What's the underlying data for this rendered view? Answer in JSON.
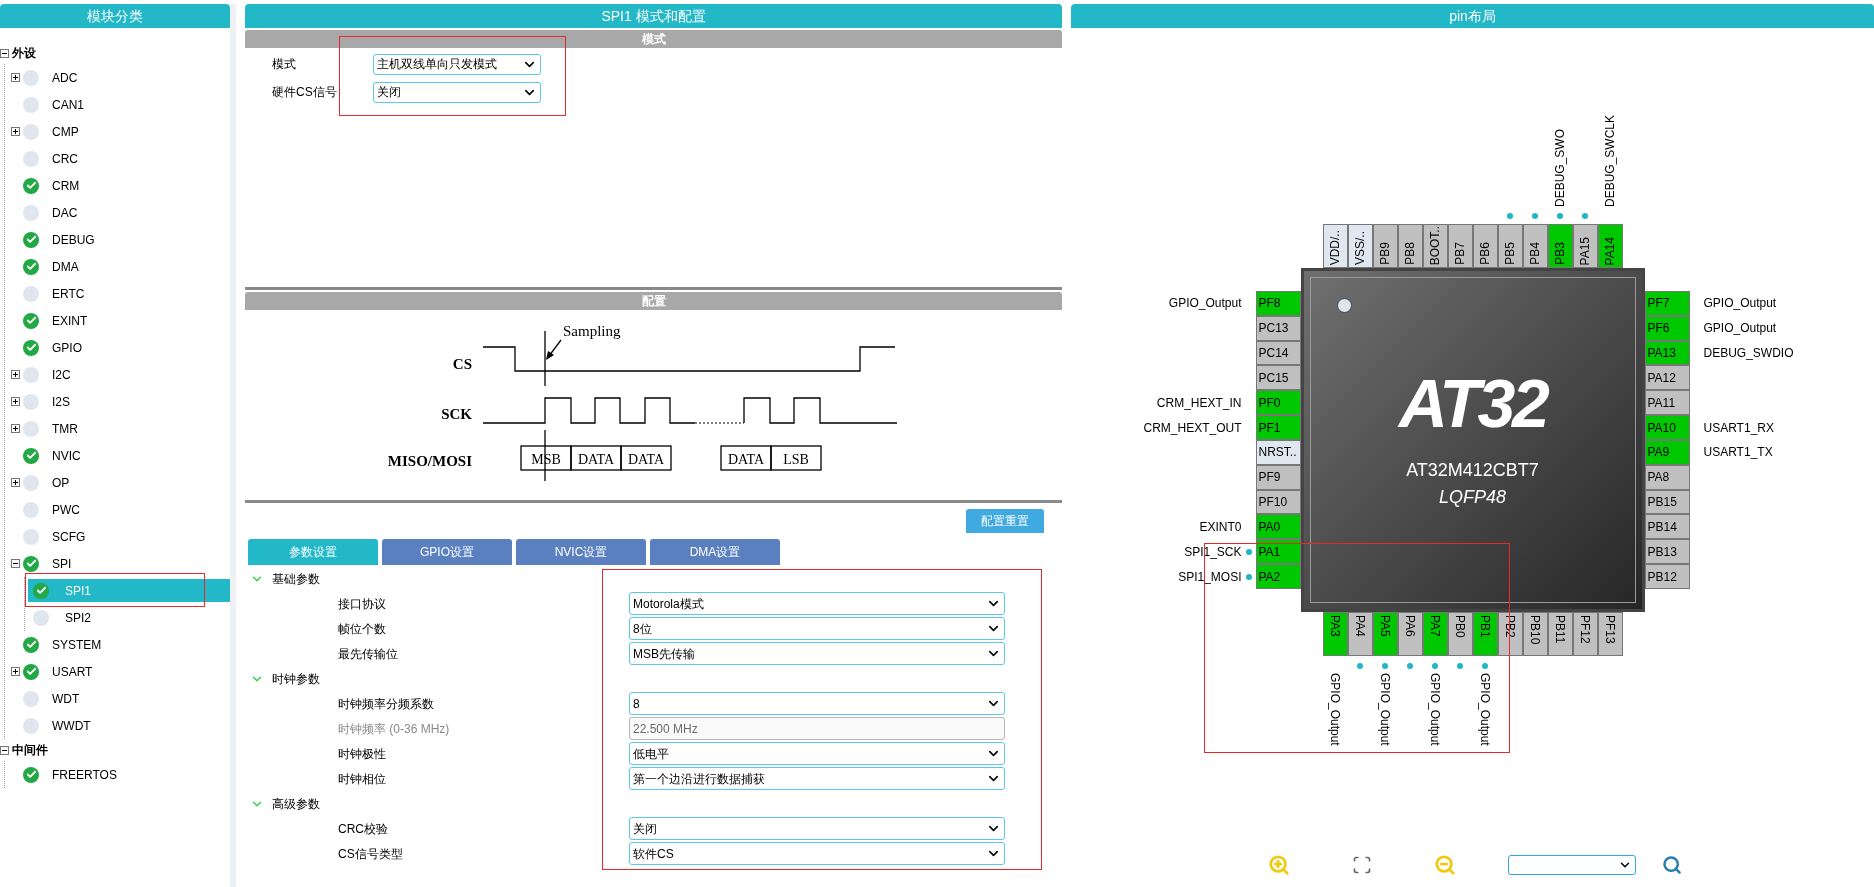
{
  "sidebar": {
    "title": "模块分类",
    "groups": [
      {
        "label": "外设",
        "expanded": true,
        "items": [
          {
            "label": "ADC",
            "enabled": false,
            "expanded": false,
            "selected": false
          },
          {
            "label": "CAN1",
            "enabled": false,
            "selected": false
          },
          {
            "label": "CMP",
            "enabled": false,
            "expanded": false,
            "selected": false
          },
          {
            "label": "CRC",
            "enabled": false,
            "selected": false
          },
          {
            "label": "CRM",
            "enabled": true,
            "selected": false
          },
          {
            "label": "DAC",
            "enabled": false,
            "selected": false
          },
          {
            "label": "DEBUG",
            "enabled": true,
            "selected": false
          },
          {
            "label": "DMA",
            "enabled": true,
            "selected": false
          },
          {
            "label": "ERTC",
            "enabled": false,
            "selected": false
          },
          {
            "label": "EXINT",
            "enabled": true,
            "selected": false
          },
          {
            "label": "GPIO",
            "enabled": true,
            "selected": false
          },
          {
            "label": "I2C",
            "enabled": false,
            "expanded": false,
            "selected": false
          },
          {
            "label": "I2S",
            "enabled": false,
            "expanded": false,
            "selected": false
          },
          {
            "label": "TMR",
            "enabled": false,
            "expanded": false,
            "selected": false
          },
          {
            "label": "NVIC",
            "enabled": true,
            "selected": false
          },
          {
            "label": "OP",
            "enabled": false,
            "expanded": false,
            "selected": false
          },
          {
            "label": "PWC",
            "enabled": false,
            "selected": false
          },
          {
            "label": "SCFG",
            "enabled": false,
            "selected": false
          },
          {
            "label": "SPI",
            "enabled": true,
            "expanded": true,
            "selected": false,
            "children": [
              {
                "label": "SPI1",
                "enabled": true,
                "selected": true,
                "highlighted": true
              },
              {
                "label": "SPI2",
                "enabled": false,
                "selected": false,
                "highlighted": false
              }
            ]
          },
          {
            "label": "SYSTEM",
            "enabled": true,
            "selected": false
          },
          {
            "label": "USART",
            "enabled": true,
            "expanded": false,
            "selected": false
          },
          {
            "label": "WDT",
            "enabled": false,
            "selected": false
          },
          {
            "label": "WWDT",
            "enabled": false,
            "selected": false
          }
        ]
      },
      {
        "label": "中间件",
        "expanded": true,
        "items": [
          {
            "label": "FREERTOS",
            "enabled": true,
            "selected": false
          }
        ]
      }
    ]
  },
  "main": {
    "title": "SPI1 模式和配置",
    "mode": {
      "title": "模式",
      "highlighted": true,
      "fields": [
        {
          "label": "模式",
          "value": "主机双线单向只发模式"
        },
        {
          "label": "硬件CS信号",
          "value": "关闭"
        }
      ]
    },
    "config": {
      "title": "配置",
      "timing_diagram": {
        "signals": [
          "CS",
          "SCK",
          "MISO/MOSI"
        ],
        "annotation": "Sampling",
        "frames": [
          "MSB",
          "DATA",
          "DATA",
          "DATA",
          "LSB"
        ]
      },
      "reset_button": "配置重置",
      "tabs": [
        {
          "label": "参数设置",
          "selected": true
        },
        {
          "label": "GPIO设置",
          "selected": false
        },
        {
          "label": "NVIC设置",
          "selected": false
        },
        {
          "label": "DMA设置",
          "selected": false
        }
      ],
      "highlighted": true,
      "groups": [
        {
          "title": "基础参数",
          "expanded": true,
          "params": [
            {
              "label": "接口协议",
              "value": "Motorola模式",
              "kind": "select"
            },
            {
              "label": "帧位个数",
              "value": "8位",
              "kind": "select"
            },
            {
              "label": "最先传输位",
              "value": "MSB先传输",
              "kind": "select"
            }
          ]
        },
        {
          "title": "时钟参数",
          "expanded": true,
          "params": [
            {
              "label": "时钟频率分频系数",
              "value": "8",
              "kind": "select"
            },
            {
              "label": "时钟频率 (0-36 MHz)",
              "value": "22.500 MHz",
              "kind": "readonly"
            },
            {
              "label": "时钟极性",
              "value": "低电平",
              "kind": "select"
            },
            {
              "label": "时钟相位",
              "value": "第一个边沿进行数据捕获",
              "kind": "select"
            }
          ]
        },
        {
          "title": "高级参数",
          "expanded": true,
          "params": [
            {
              "label": "CRC校验",
              "value": "关闭",
              "kind": "select"
            },
            {
              "label": "CS信号类型",
              "value": "软件CS",
              "kind": "select"
            }
          ]
        }
      ]
    }
  },
  "pinout": {
    "title": "pin布局",
    "highlighted": true,
    "chip": {
      "logo": "AT32",
      "part": "AT32M412CBT7",
      "package": "LQFP48"
    },
    "pins": {
      "top": [
        {
          "name": "VDD/..",
          "color": "#dfe8f1",
          "dot": false
        },
        {
          "name": "VSS/..",
          "color": "#dfe8f1",
          "dot": false
        },
        {
          "name": "PB9",
          "color": "#c0c0c0",
          "dot": false
        },
        {
          "name": "PB8",
          "color": "#c0c0c0",
          "dot": false
        },
        {
          "name": "BOOT..",
          "color": "#c0c0c0",
          "dot": false
        },
        {
          "name": "PB7",
          "color": "#c0c0c0",
          "dot": false
        },
        {
          "name": "PB6",
          "color": "#c0c0c0",
          "dot": false
        },
        {
          "name": "PB5",
          "color": "#c0c0c0",
          "dot": true
        },
        {
          "name": "PB4",
          "color": "#c0c0c0",
          "dot": true
        },
        {
          "name": "PB3",
          "color": "#00c800",
          "dot": true,
          "signal": "DEBUG_SWO"
        },
        {
          "name": "PA15",
          "color": "#c0c0c0",
          "dot": true
        },
        {
          "name": "PA14",
          "color": "#00c800",
          "dot": false,
          "signal": "DEBUG_SWCLK"
        }
      ],
      "left": [
        {
          "name": "PF8",
          "color": "#00c800",
          "dot": false,
          "signal": "GPIO_Output"
        },
        {
          "name": "PC13",
          "color": "#c0c0c0",
          "dot": false
        },
        {
          "name": "PC14",
          "color": "#c0c0c0",
          "dot": false
        },
        {
          "name": "PC15",
          "color": "#c0c0c0",
          "dot": false
        },
        {
          "name": "PF0",
          "color": "#00c800",
          "dot": false,
          "signal": "CRM_HEXT_IN"
        },
        {
          "name": "PF1",
          "color": "#00c800",
          "dot": false,
          "signal": "CRM_HEXT_OUT"
        },
        {
          "name": "NRST..",
          "color": "#dfe8f1",
          "dot": false
        },
        {
          "name": "PF9",
          "color": "#c0c0c0",
          "dot": false
        },
        {
          "name": "PF10",
          "color": "#c0c0c0",
          "dot": false
        },
        {
          "name": "PA0",
          "color": "#00c800",
          "dot": false,
          "signal": "EXINT0"
        },
        {
          "name": "PA1",
          "color": "#00c800",
          "dot": true,
          "signal": "SPI1_SCK"
        },
        {
          "name": "PA2",
          "color": "#00c800",
          "dot": true,
          "signal": "SPI1_MOSI"
        }
      ],
      "right": [
        {
          "name": "PF7",
          "color": "#00c800",
          "dot": false,
          "signal": "GPIO_Output"
        },
        {
          "name": "PF6",
          "color": "#00c800",
          "dot": false,
          "signal": "GPIO_Output"
        },
        {
          "name": "PA13",
          "color": "#00c800",
          "dot": false,
          "signal": "DEBUG_SWDIO"
        },
        {
          "name": "PA12",
          "color": "#c0c0c0",
          "dot": false
        },
        {
          "name": "PA11",
          "color": "#c0c0c0",
          "dot": false
        },
        {
          "name": "PA10",
          "color": "#00c800",
          "dot": false,
          "signal": "USART1_RX"
        },
        {
          "name": "PA9",
          "color": "#00c800",
          "dot": false,
          "signal": "USART1_TX"
        },
        {
          "name": "PA8",
          "color": "#c0c0c0",
          "dot": false
        },
        {
          "name": "PB15",
          "color": "#c0c0c0",
          "dot": false
        },
        {
          "name": "PB14",
          "color": "#c0c0c0",
          "dot": false
        },
        {
          "name": "PB13",
          "color": "#c0c0c0",
          "dot": false
        },
        {
          "name": "PB12",
          "color": "#c0c0c0",
          "dot": false
        }
      ],
      "bottom": [
        {
          "name": "PA3",
          "color": "#00c800",
          "dot": false,
          "signal": "GPIO_Output"
        },
        {
          "name": "PA4",
          "color": "#c0c0c0",
          "dot": true
        },
        {
          "name": "PA5",
          "color": "#00c800",
          "dot": true,
          "signal": "GPIO_Output"
        },
        {
          "name": "PA6",
          "color": "#c0c0c0",
          "dot": true
        },
        {
          "name": "PA7",
          "color": "#00c800",
          "dot": true,
          "signal": "GPIO_Output"
        },
        {
          "name": "PB0",
          "color": "#c0c0c0",
          "dot": true
        },
        {
          "name": "PB1",
          "color": "#00c800",
          "dot": true,
          "signal": "GPIO_Output"
        },
        {
          "name": "PB2",
          "color": "#c0c0c0",
          "dot": false
        },
        {
          "name": "PB10",
          "color": "#c0c0c0",
          "dot": false
        },
        {
          "name": "PB11",
          "color": "#c0c0c0",
          "dot": false
        },
        {
          "name": "PF12",
          "color": "#c0c0c0",
          "dot": false
        },
        {
          "name": "PF13",
          "color": "#c0c0c0",
          "dot": false
        }
      ]
    }
  }
}
